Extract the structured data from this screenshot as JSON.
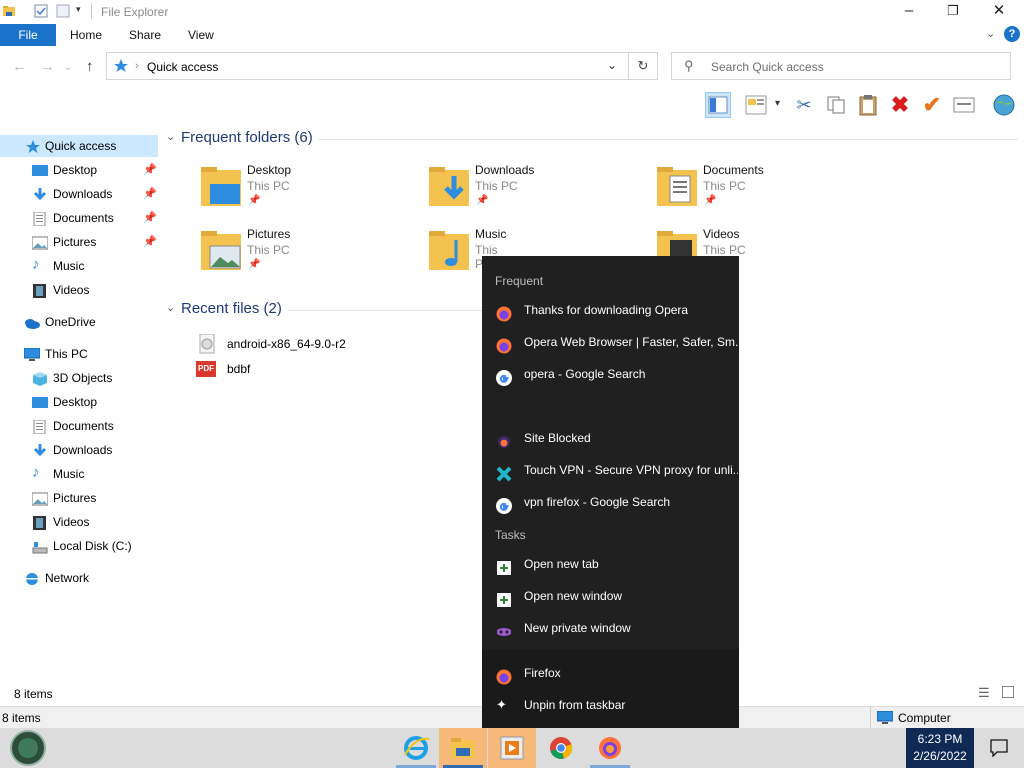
{
  "window": {
    "title": "File Explorer"
  },
  "ribbon": {
    "tabs": [
      "File",
      "Home",
      "Share",
      "View"
    ]
  },
  "address": {
    "path": "Quick access"
  },
  "search": {
    "placeholder": "Search Quick access"
  },
  "nav": {
    "quick_access": "Quick access",
    "qa_items": [
      "Desktop",
      "Downloads",
      "Documents",
      "Pictures",
      "Music",
      "Videos"
    ],
    "onedrive": "OneDrive",
    "this_pc": "This PC",
    "pc_items": [
      "3D Objects",
      "Desktop",
      "Documents",
      "Downloads",
      "Music",
      "Pictures",
      "Videos",
      "Local Disk (C:)"
    ],
    "network": "Network"
  },
  "frequent": {
    "title": "Frequent folders (6)",
    "folders": [
      {
        "name": "Desktop",
        "location": "This PC"
      },
      {
        "name": "Downloads",
        "location": "This PC"
      },
      {
        "name": "Documents",
        "location": "This PC"
      },
      {
        "name": "Pictures",
        "location": "This PC"
      },
      {
        "name": "Music",
        "location": "This PC"
      },
      {
        "name": "Videos",
        "location": "This PC"
      }
    ]
  },
  "recent": {
    "title": "Recent files (2)",
    "files": [
      {
        "name": "android-x86_64-9.0-r2",
        "icon": "disc-image-icon"
      },
      {
        "name": "bdbf",
        "icon": "pdf-icon"
      }
    ]
  },
  "jumplist": {
    "frequent_header": "Frequent",
    "frequent": [
      "Thanks for downloading Opera",
      "Opera Web Browser | Faster, Safer, Sm...",
      "opera - Google Search",
      "Site Blocked",
      "Touch VPN - Secure VPN proxy for unli...",
      "vpn firefox - Google Search"
    ],
    "tasks_header": "Tasks",
    "tasks": [
      "Open new tab",
      "Open new window",
      "New private window"
    ],
    "app": "Firefox",
    "unpin": "Unpin from taskbar"
  },
  "status": {
    "items": "8 items",
    "items2": "8 items",
    "computer": "Computer"
  },
  "clock": {
    "time": "6:23 PM",
    "date": "2/26/2022"
  },
  "colors": {
    "accent": "#1a73c8",
    "folder": "#f3c24f",
    "jumplist_bg": "#202020",
    "clock_bg": "#0e2a55"
  }
}
